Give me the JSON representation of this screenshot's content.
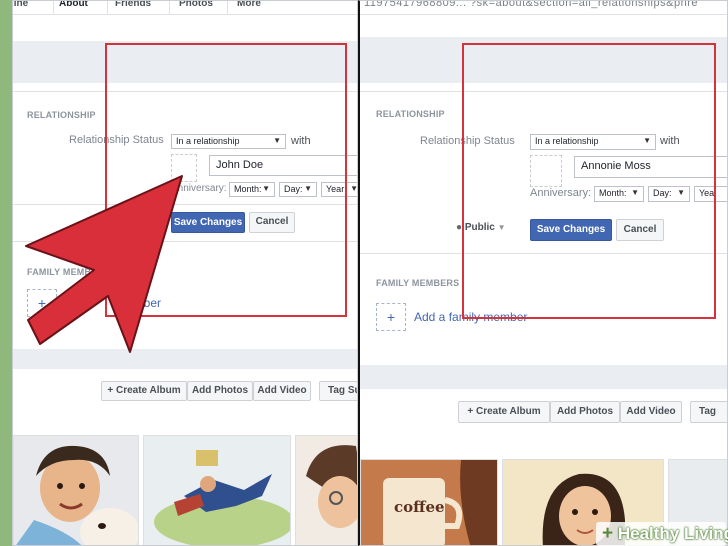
{
  "left_panel": {
    "tabs": [
      "line",
      "About",
      "Friends",
      "Photos",
      "More"
    ],
    "relationship_heading": "RELATIONSHIP",
    "relationship_status_label": "Relationship Status",
    "status_select": "In a relationship",
    "with_label": "with",
    "partner_name": "John Doe",
    "anniversary_label": "Anniversary:",
    "month_select": "Month:",
    "day_select": "Day:",
    "year_select": "Year:",
    "save_button": "Save Changes",
    "cancel_button": "Cancel",
    "family_heading": "FAMILY MEMB",
    "add_family_link": "member",
    "photo_buttons": [
      "Create Album",
      "Add Photos",
      "Add Video",
      "Tag Su"
    ]
  },
  "right_panel": {
    "url_text": "11975417968809... ?sk=about&section=all_relationships&pnre",
    "relationship_heading": "RELATIONSHIP",
    "relationship_status_label": "Relationship Status",
    "status_select": "In a relationship",
    "with_label": "with",
    "partner_name": "Annonie Moss",
    "anniversary_label": "Anniversary:",
    "month_select": "Month:",
    "day_select": "Day:",
    "year_select": "Yea",
    "privacy_label": "Public",
    "save_button": "Save Changes",
    "cancel_button": "Cancel",
    "family_heading": "FAMILY MEMBERS",
    "add_family_link": "Add a family member",
    "photo_buttons": [
      "Create Album",
      "Add Photos",
      "Add Video",
      "Tag"
    ]
  },
  "watermark": {
    "plus": "+",
    "text": "Healthy Living"
  },
  "colors": {
    "background": "#8fb97c",
    "primary_button": "#4267b2",
    "highlight_box": "#d4333c",
    "arrow": "#d92f3a"
  }
}
